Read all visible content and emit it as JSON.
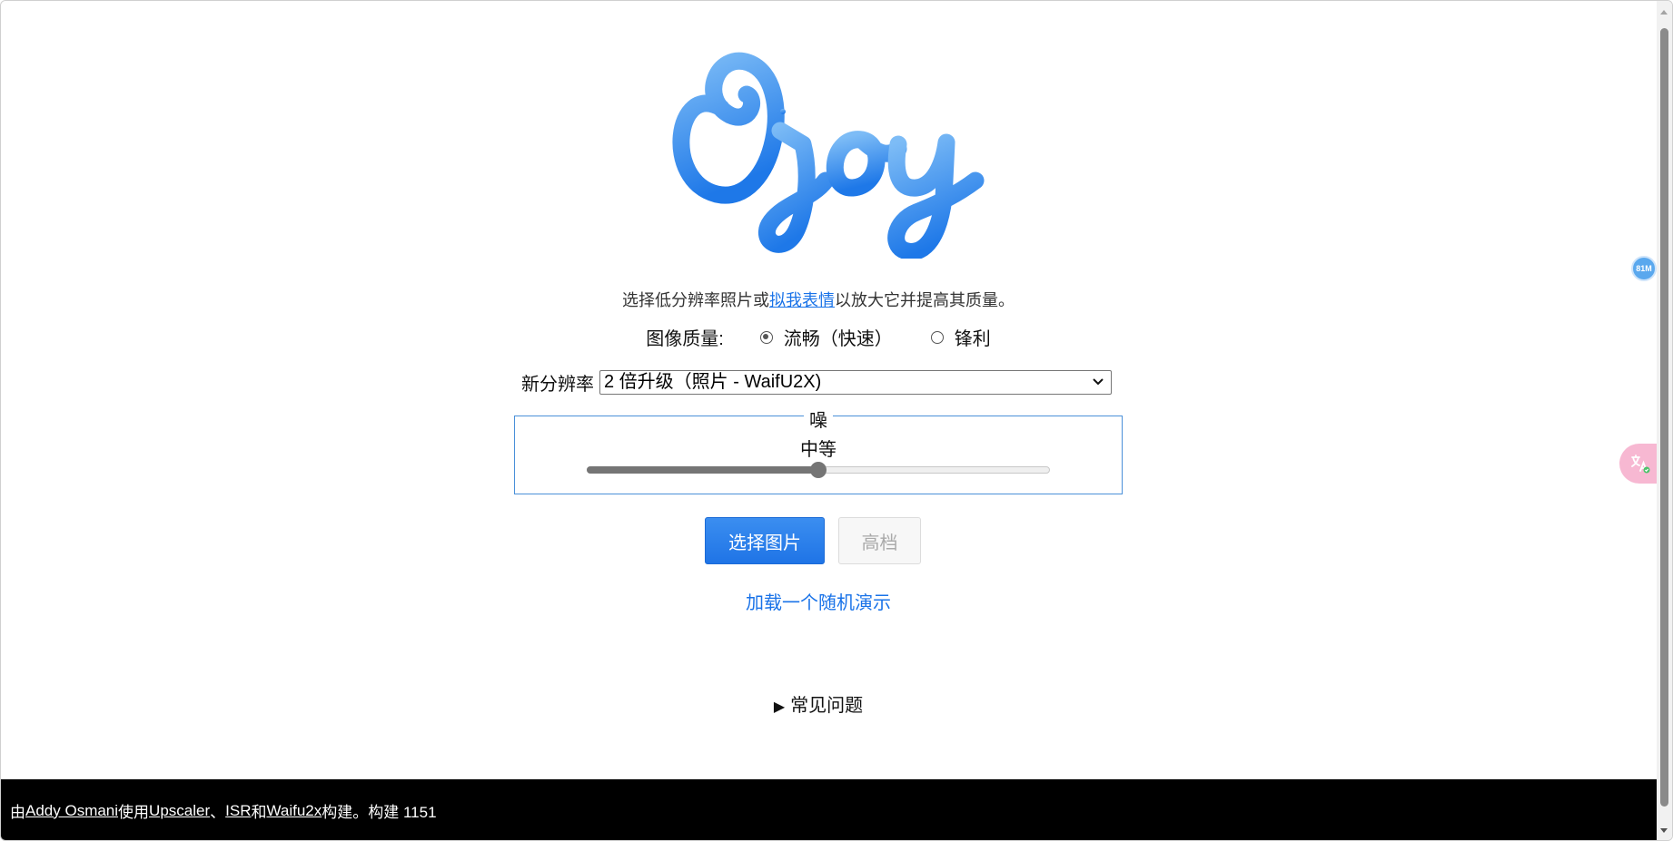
{
  "tagline": {
    "prefix": "选择低分辨率照片或",
    "link": "拟我表情",
    "suffix": "以放大它并提高其质量。"
  },
  "quality": {
    "label": "图像质量:",
    "options": [
      {
        "label": "流畅（快速）",
        "selected": true
      },
      {
        "label": "锋利",
        "selected": false
      }
    ]
  },
  "resolution": {
    "label": "新分辨率",
    "selected": "2 倍升级（照片 - WaifU2X)"
  },
  "noise": {
    "legend": "噪",
    "value_label": "中等",
    "level_fraction": 0.5
  },
  "buttons": {
    "select_image": "选择图片",
    "high_quality": "高档"
  },
  "demo_link": "加载一个随机演示",
  "faq": {
    "marker": "▶",
    "label": "常见问题"
  },
  "footer": {
    "by": "由 ",
    "author": "Addy Osmani",
    "using": " 使用 ",
    "upscaler": "Upscaler",
    "sep1": "、",
    "isr": "ISR",
    "and": " 和 ",
    "waifu": "Waifu2x",
    "built": " 构建。构建 1151"
  },
  "extension_badge": "81M",
  "colors": {
    "accent": "#1a73e8",
    "logo_light": "#6fb3f5",
    "logo_dark": "#1f7ae8",
    "footer_bg": "#000000"
  }
}
